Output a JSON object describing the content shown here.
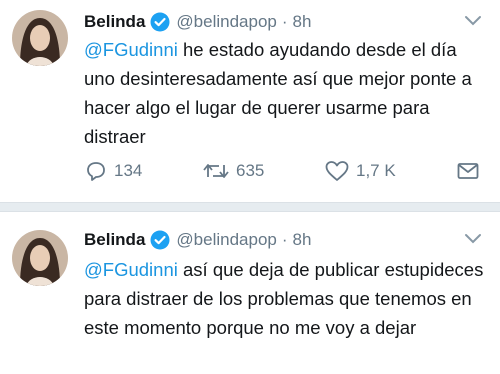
{
  "tweets": [
    {
      "author_name": "Belinda",
      "handle": "@belindapop",
      "separator": "·",
      "time": "8h",
      "mention": "@FGudinni",
      "text": " he estado ayudando desde el día uno desinteresadamente así que mejor ponte a hacer algo el lugar de querer usarme para distraer",
      "reply_count": "134",
      "retweet_count": "635",
      "like_count": "1,7 K"
    },
    {
      "author_name": "Belinda",
      "handle": "@belindapop",
      "separator": "·",
      "time": "8h",
      "mention": "@FGudinni",
      "text": " así que deja de publicar estupideces para distraer de los problemas que tenemos en este momento porque no me voy a dejar"
    }
  ],
  "icons": {
    "verified": "verified-badge-icon",
    "caret": "chevron-down-icon",
    "reply": "reply-icon",
    "retweet": "retweet-icon",
    "like": "heart-icon",
    "dm": "envelope-icon"
  },
  "colors": {
    "link": "#1b95e0",
    "muted": "#657786",
    "verified": "#1da1f2",
    "divider": "#e6ecf0"
  }
}
